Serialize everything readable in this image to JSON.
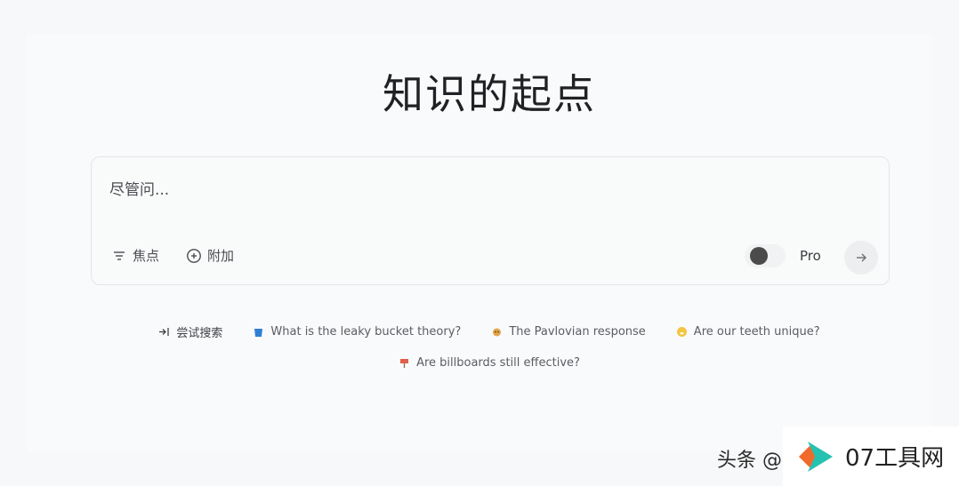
{
  "hero": {
    "title": "知识的起点"
  },
  "search": {
    "placeholder": "尽管问...",
    "focus_label": "焦点",
    "attach_label": "附加",
    "pro_label": "Pro",
    "pro_enabled": false
  },
  "suggestions": {
    "label": "尝试搜索",
    "items": [
      {
        "icon": "bucket-icon",
        "text": "What is the leaky bucket theory?"
      },
      {
        "icon": "dog-icon",
        "text": "The Pavlovian response"
      },
      {
        "icon": "face-icon",
        "text": "Are our teeth unique?"
      },
      {
        "icon": "billboard-icon",
        "text": "Are billboards still effective?"
      }
    ]
  },
  "watermark": {
    "prefix": "头条 @",
    "brand": "07工具网"
  },
  "colors": {
    "accent_orange": "#f26a2b",
    "accent_teal": "#25c1b1",
    "knob": "#4b4b4b"
  }
}
